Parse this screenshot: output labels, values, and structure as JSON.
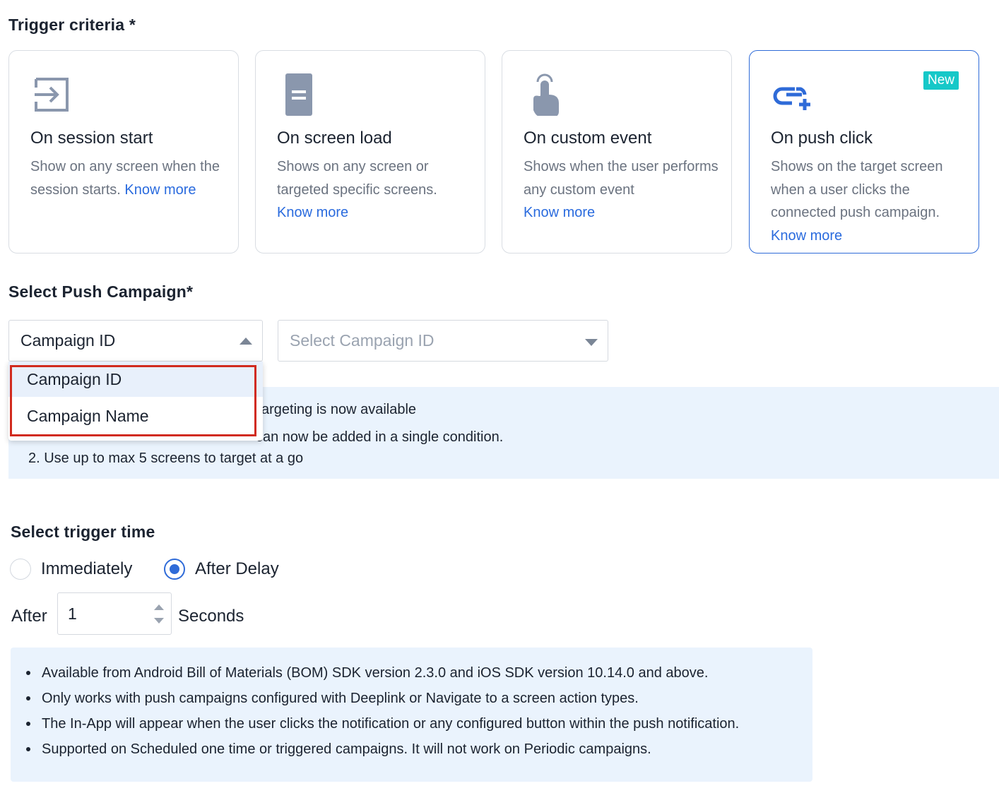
{
  "trigger_criteria": {
    "title": "Trigger criteria *",
    "cards": [
      {
        "title": "On session start",
        "desc": "Show on any screen when the session starts.",
        "link": "Know more",
        "icon": "session-enter-icon"
      },
      {
        "title": "On screen load",
        "desc": "Shows on any screen or targeted specific screens.",
        "link": "Know more",
        "icon": "document-icon"
      },
      {
        "title": "On custom event",
        "desc": "Shows when the user performs any custom event",
        "link": "Know more",
        "icon": "tap-hand-icon"
      },
      {
        "title": "On push click",
        "desc": "Shows on the target screen when a user clicks the connected push campaign.",
        "link": "Know more",
        "icon": "push-click-icon",
        "badge": "New"
      }
    ]
  },
  "push_campaign": {
    "title": "Select Push Campaign*",
    "type_select": "Campaign ID",
    "id_select_placeholder": "Select Campaign ID",
    "dropdown_options": [
      "Campaign ID",
      "Campaign Name"
    ]
  },
  "info": {
    "heading_partial": "argeting is now available",
    "line1_partial": "can now be added in a single condition.",
    "line2": "2. Use up to max 5 screens to target at a go"
  },
  "trigger_time": {
    "title": "Select trigger time",
    "options": [
      "Immediately",
      "After Delay"
    ],
    "selected": "After Delay",
    "after_label": "After",
    "delay_value": "1",
    "unit": "Seconds"
  },
  "notes": [
    "Available from Android Bill of Materials (BOM) SDK version 2.3.0 and iOS SDK version 10.14.0 and above.",
    "Only works with push campaigns configured with Deeplink or Navigate to a screen action types.",
    "The In-App will appear when the user clicks the notification or any configured button within the push notification.",
    "Supported on Scheduled one time or triggered campaigns. It will not work on Periodic campaigns."
  ],
  "colors": {
    "accent": "#2f6bd8",
    "link": "#2a6bde",
    "badge": "#16c8c8",
    "highlight": "#d12b1e",
    "info_bg": "#eaf3fd"
  }
}
